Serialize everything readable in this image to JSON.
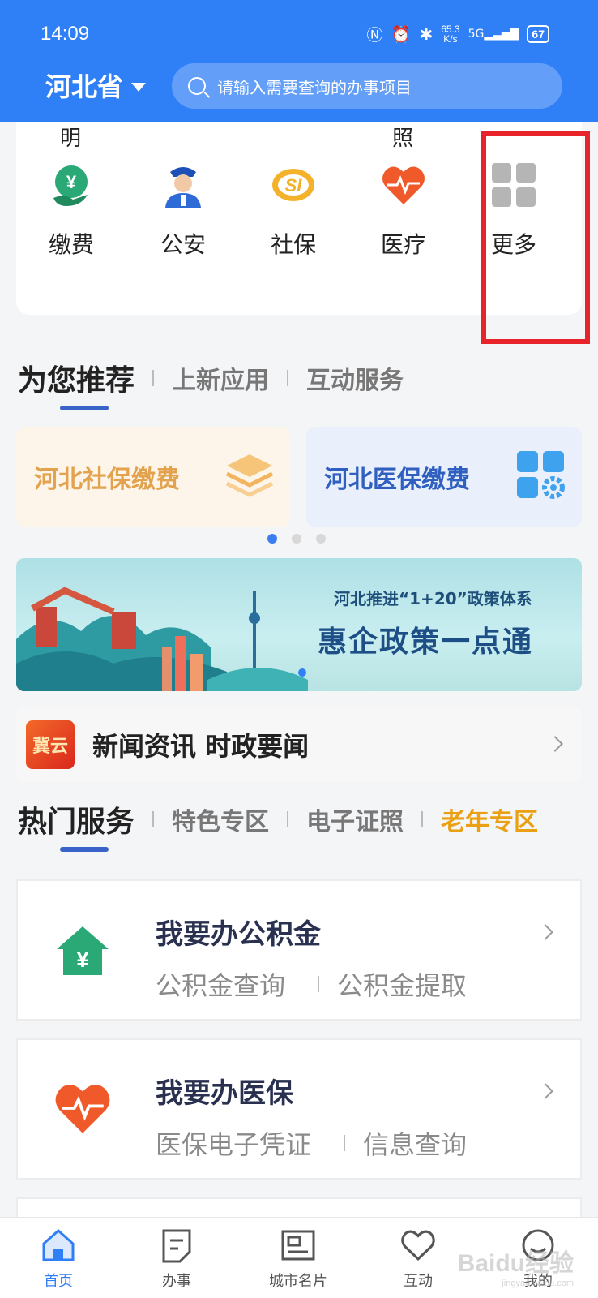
{
  "status_bar": {
    "time": "14:09",
    "net_speed_value": "65.3",
    "net_speed_unit": "K/s",
    "network": "5G",
    "battery": "67"
  },
  "header": {
    "province": "河北省",
    "search_placeholder": "请输入需要查询的办事项目"
  },
  "categories": {
    "prev_row_partial": [
      "明",
      "照"
    ],
    "items": [
      {
        "label": "缴费",
        "icon": "payment-icon"
      },
      {
        "label": "公安",
        "icon": "police-icon"
      },
      {
        "label": "社保",
        "icon": "social-security-icon"
      },
      {
        "label": "医疗",
        "icon": "medical-heart-icon"
      },
      {
        "label": "更多",
        "icon": "more-grid-icon"
      }
    ]
  },
  "recommend": {
    "tabs": [
      "为您推荐",
      "上新应用",
      "互动服务"
    ],
    "cards": [
      {
        "label": "河北社保缴费",
        "icon": "layers-icon"
      },
      {
        "label": "河北医保缴费",
        "icon": "apps-gear-icon"
      }
    ]
  },
  "banner": {
    "subtitle": "河北推进“1+20”政策体系",
    "title": "惠企政策一点通"
  },
  "news": {
    "logo_text": "冀云",
    "text": "新闻资讯 时政要闻"
  },
  "hot_services": {
    "tabs": [
      "热门服务",
      "特色专区",
      "电子证照",
      "老年专区"
    ],
    "items": [
      {
        "title": "我要办公积金",
        "links": [
          "公积金查询",
          "公积金提取"
        ],
        "icon": "housing-fund-icon"
      },
      {
        "title": "我要办医保",
        "links": [
          "医保电子凭证",
          "信息查询"
        ],
        "icon": "medical-insurance-icon"
      }
    ]
  },
  "bottom_nav": [
    {
      "label": "首页",
      "icon": "home-icon"
    },
    {
      "label": "办事",
      "icon": "tasks-icon"
    },
    {
      "label": "城市名片",
      "icon": "city-card-icon"
    },
    {
      "label": "互动",
      "icon": "heart-icon"
    },
    {
      "label": "我的",
      "icon": "profile-icon"
    }
  ],
  "watermark": {
    "text": "Baidu经验",
    "sub": "jingyan.baidu.com"
  },
  "colors": {
    "brand_blue": "#2f7ff6",
    "highlight_red": "#e8232a",
    "orange_tab": "#eaa012"
  }
}
